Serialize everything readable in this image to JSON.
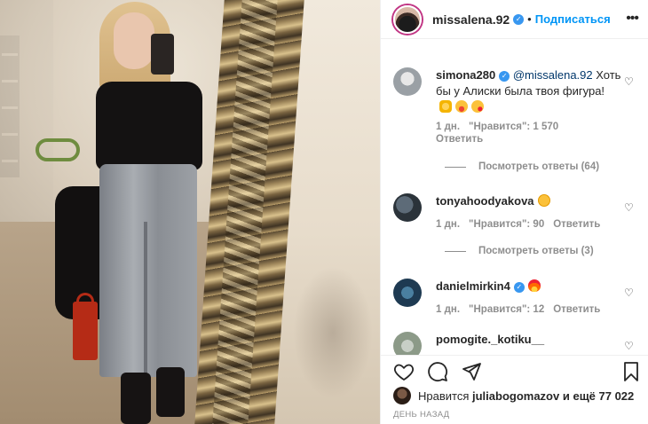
{
  "post": {
    "username": "missalena.92",
    "follow_label": "Подписаться",
    "separator": "•",
    "more_label": "•••"
  },
  "comments": [
    {
      "username": "simona280",
      "mention": "@missalena.92",
      "text": "Хоть бы у Алиски была твоя фигура!",
      "time": "1 дн.",
      "likes": "\"Нравится\": 1 570",
      "reply": "Ответить",
      "view_replies": "Посмотреть ответы (64)"
    },
    {
      "username": "tonyahoodyakova",
      "time": "1 дн.",
      "likes": "\"Нравится\": 90",
      "reply": "Ответить",
      "view_replies": "Посмотреть ответы (3)"
    },
    {
      "username": "danielmirkin4",
      "time": "1 дн.",
      "likes": "\"Нравится\": 12",
      "reply": "Ответить"
    },
    {
      "username": "pomogite._kotiku__"
    }
  ],
  "likes_line": {
    "prefix": "Нравится",
    "user": "juliabogomazov",
    "suffix": "и ещё 77 022"
  },
  "posted_ago": "ДЕНЬ НАЗАД",
  "icons": {
    "like": "heart-icon",
    "comment": "comment-icon",
    "share": "share-icon",
    "save": "bookmark-icon",
    "verified": "verified-badge"
  },
  "colors": {
    "accent": "#0095f6",
    "verified": "#3897f0",
    "muted": "#8e8e8e",
    "text": "#262626"
  }
}
